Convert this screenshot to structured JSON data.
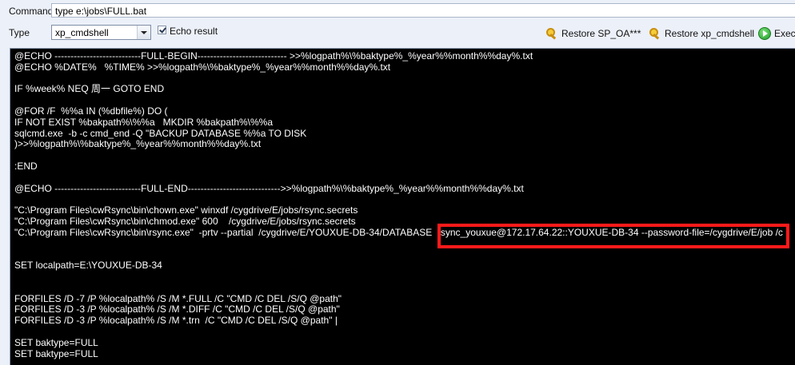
{
  "command": {
    "label": "Command",
    "value": "type e:\\jobs\\FULL.bat"
  },
  "type": {
    "label": "Type",
    "selected": "xp_cmdshell"
  },
  "echo": {
    "label": "Echo result",
    "checked": true
  },
  "toolbar": {
    "restore_sp_oa": "Restore SP_OA***",
    "restore_xp_cmdshell": "Restore xp_cmdshell",
    "execute": "Execu"
  },
  "editor": {
    "lines": [
      "@ECHO ---------------------------FULL-BEGIN---------------------------- >>%logpath%\\%baktype%_%year%%month%%day%.txt",
      "@ECHO %DATE%   %TIME% >>%logpath%\\%baktype%_%year%%month%%day%.txt",
      "",
      "IF %week% NEQ 周一 GOTO END",
      "",
      "@FOR /F  %%a IN (%dbfile%) DO (",
      "IF NOT EXIST %bakpath%\\%%a   MKDIR %bakpath%\\%%a",
      "sqlcmd.exe  -b -c cmd_end -Q \"BACKUP DATABASE %%a TO DISK",
      ")>>%logpath%\\%baktype%_%year%%month%%day%.txt",
      "",
      ":END",
      "",
      "@ECHO ---------------------------FULL-END----------------------------->>%logpath%\\%baktype%_%year%%month%%day%.txt",
      "",
      "\"C:\\Program Files\\cwRsync\\bin\\chown.exe\" winxdf /cygdrive/E/jobs/rsync.secrets",
      "\"C:\\Program Files\\cwRsync\\bin\\chmod.exe\" 600    /cygdrive/E/jobs/rsync.secrets",
      "\"C:\\Program Files\\cwRsync\\bin\\rsync.exe\"  -prtv --partial  /cygdrive/E/YOUXUE-DB-34/DATABASE  rsync_youxue@172.17.64.22::YOUXUE-DB-34 --password-file=/cygdrive/E/job /c",
      "",
      "",
      "SET localpath=E:\\YOUXUE-DB-34",
      "",
      "",
      "FORFILES /D -7 /P %localpath% /S /M *.FULL /C \"CMD /C DEL /S/Q @path\"",
      "FORFILES /D -3 /P %localpath% /S /M *.DIFF /C \"CMD /C DEL /S/Q @path\"",
      "FORFILES /D -3 /P %localpath% /S /M *.trn  /C \"CMD /C DEL /S/Q @path\" |",
      "",
      "SET baktype=FULL",
      "SET baktype=FULL"
    ]
  }
}
